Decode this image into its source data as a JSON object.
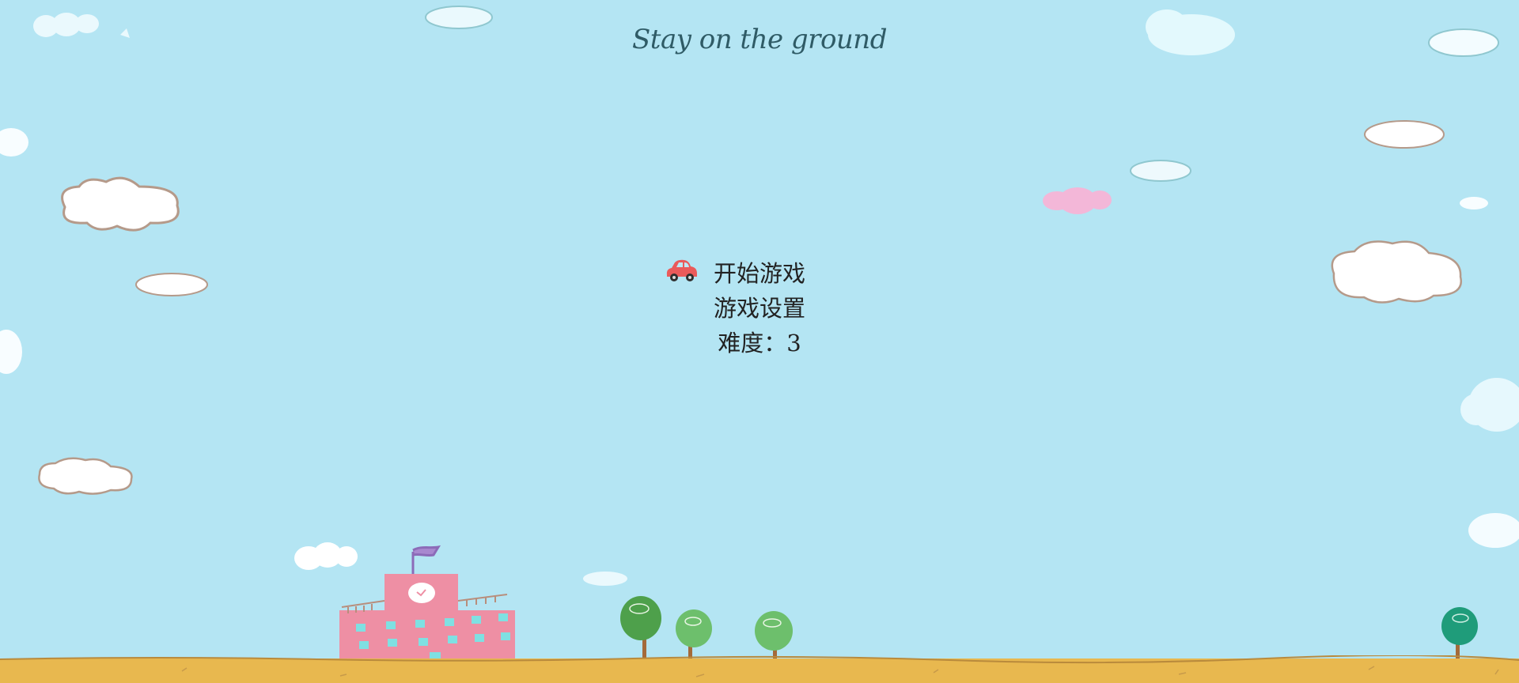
{
  "game": {
    "title": "Stay on the ground",
    "menu": {
      "start_label": "开始游戏",
      "settings_label": "游戏设置",
      "difficulty_label": "难度：",
      "difficulty_value": "3",
      "selected_index": 0
    },
    "selector_icon": "car-icon"
  },
  "colors": {
    "sky": "#b4e5f3",
    "ground": "#e8b84f",
    "school": "#ee8fa4",
    "tree": "#5fb864"
  }
}
